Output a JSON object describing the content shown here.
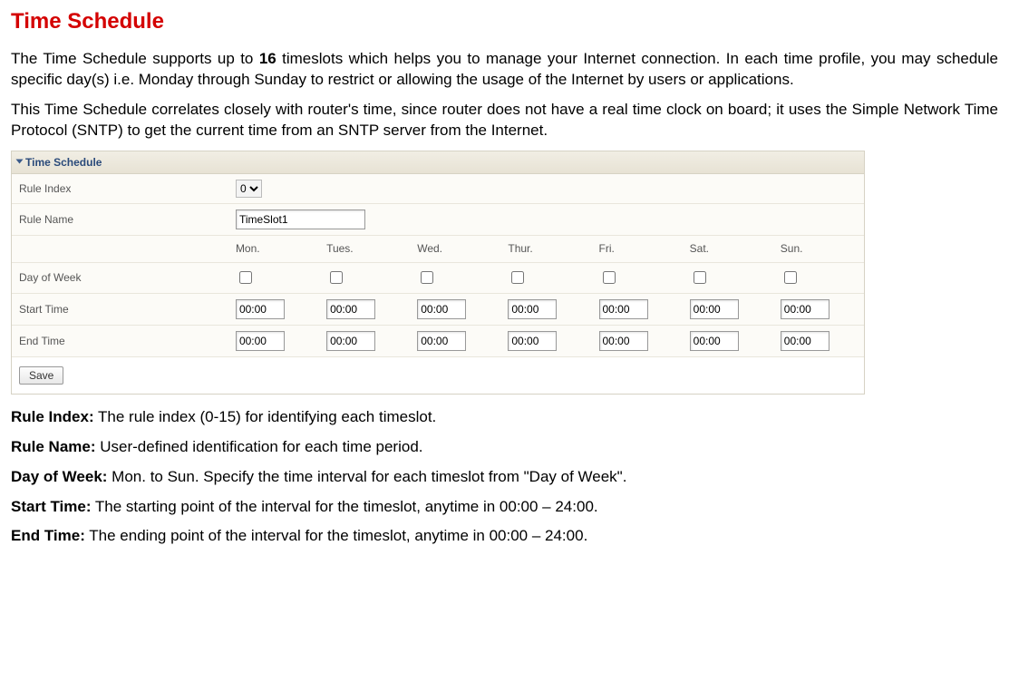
{
  "title": "Time Schedule",
  "para1_a": "The Time Schedule supports up to ",
  "para1_b": "16",
  "para1_c": " timeslots which helps you to manage your Internet connection. In each time profile, you may schedule specific day(s) i.e. Monday through Sunday to restrict or allowing the usage of the Internet by users or applications.",
  "para2": "This Time Schedule correlates closely with router's time, since router does not have a real time clock on board; it uses the Simple Network Time Protocol (SNTP) to get the current time from an SNTP server from the Internet.",
  "panel": {
    "heading": "Time Schedule",
    "rows": {
      "rule_index_label": "Rule Index",
      "rule_index_value": "0",
      "rule_name_label": "Rule Name",
      "rule_name_value": "TimeSlot1",
      "days": [
        "Mon.",
        "Tues.",
        "Wed.",
        "Thur.",
        "Fri.",
        "Sat.",
        "Sun."
      ],
      "day_of_week_label": "Day of Week",
      "start_time_label": "Start Time",
      "end_time_label": "End Time",
      "start_times": [
        "00:00",
        "00:00",
        "00:00",
        "00:00",
        "00:00",
        "00:00",
        "00:00"
      ],
      "end_times": [
        "00:00",
        "00:00",
        "00:00",
        "00:00",
        "00:00",
        "00:00",
        "00:00"
      ],
      "save_label": "Save"
    }
  },
  "defs": [
    {
      "term": "Rule Index:",
      "desc": " The rule index (0-15) for identifying each timeslot."
    },
    {
      "term": "Rule Name:",
      "desc": " User-defined identification for each time period."
    },
    {
      "term": "Day of Week:",
      "desc": " Mon. to Sun. Specify the time interval for each timeslot from \"Day of Week\"."
    },
    {
      "term": "Start Time:",
      "desc": " The starting point of the interval for the timeslot, anytime in 00:00 – 24:00."
    },
    {
      "term": "End Time:",
      "desc": " The ending point of the interval for the timeslot, anytime in 00:00 – 24:00."
    }
  ]
}
